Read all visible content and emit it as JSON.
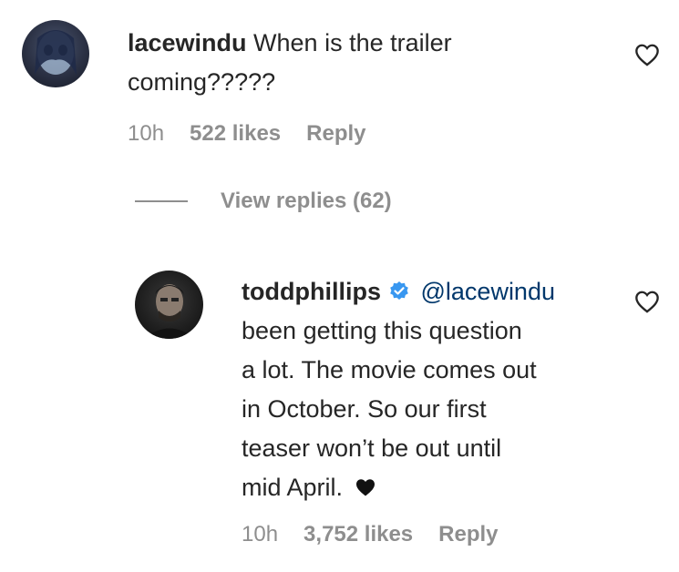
{
  "comments": [
    {
      "username": "lacewindu",
      "text_line1": " When is the trailer",
      "text_line2": "coming?????",
      "time": "10h",
      "likes": "522 likes",
      "reply_label": "Reply",
      "view_replies": "View replies (62)"
    },
    {
      "username": "toddphillips",
      "mention": "@lacewindu",
      "lines": [
        "been getting this question",
        "a lot. The movie comes out",
        "in October. So our first",
        "teaser won’t be out until",
        "mid April. "
      ],
      "time": "10h",
      "likes": "3,752 likes",
      "reply_label": "Reply"
    }
  ],
  "icons": {
    "like": "heart-outline-icon",
    "verified": "verified-badge-icon",
    "emoji": "black-heart-icon"
  },
  "colors": {
    "text": "#262626",
    "meta": "#8e8e8e",
    "verified": "#3897f0",
    "mention": "#00376b"
  }
}
